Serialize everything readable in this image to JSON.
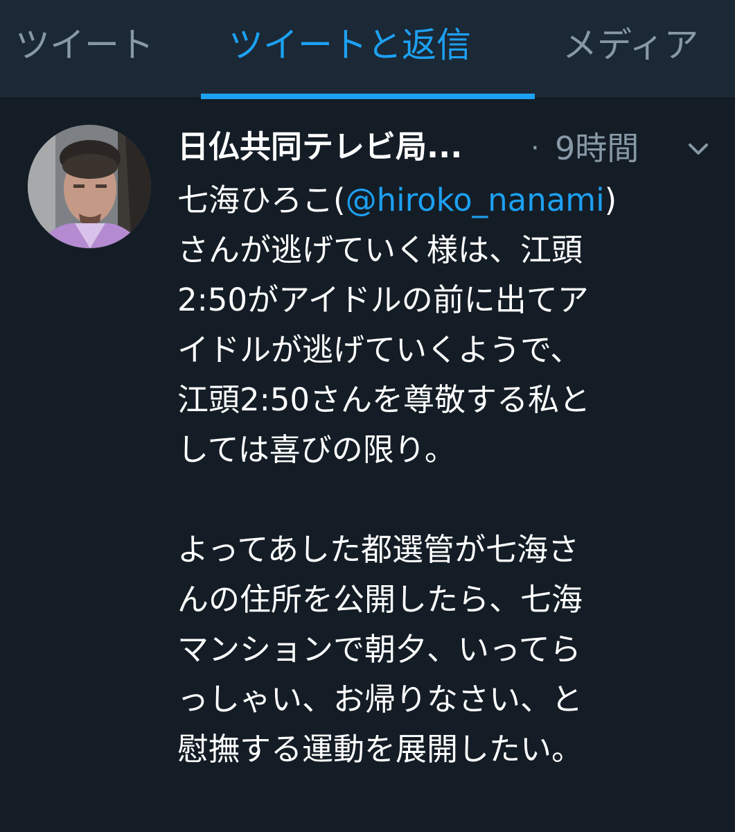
{
  "tabs": [
    {
      "label": "ツイート",
      "active": false
    },
    {
      "label": "ツイートと返信",
      "active": true
    },
    {
      "label": "メディア",
      "active": false
    }
  ],
  "tweet": {
    "display_name": "日仏共同テレビ局...",
    "separator": "·",
    "time": "9時間",
    "menu_icon": "chevron-down-icon",
    "line1_prefix": "七海ひろこ(",
    "mention": "@hiroko_nanami",
    "line1_suffix": ")",
    "lines_part1": [
      "さんが逃げていく様は、江頭",
      "2:50がアイドルの前に出てア",
      "イドルが逃げていくようで、",
      "江頭2:50さんを尊敬する私と",
      "しては喜びの限り。"
    ],
    "lines_part2": [
      "よってあした都選管が七海さ",
      "んの住所を公開したら、七海",
      "マンションで朝夕、いってら",
      "っしゃい、お帰りなさい、と",
      "慰撫する運動を展開したい。"
    ]
  },
  "colors": {
    "background": "#141d26",
    "tabbar": "#1b2836",
    "accent": "#1da1f2",
    "muted": "#8899a6",
    "text": "#ffffff"
  }
}
